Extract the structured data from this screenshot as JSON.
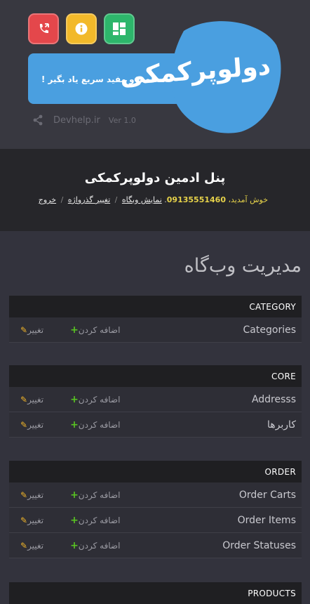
{
  "header": {
    "brand_title": "دولوپرکمکی",
    "brand_subtitle": "مختصر و مفید سریع یاد بگیر !",
    "site": "Devhelp.ir",
    "version": "Ver 1.0",
    "icons": [
      "phone-icon",
      "info-icon",
      "grid-icon"
    ],
    "colors": {
      "red": "#e4474b",
      "yellow": "#f2b92a",
      "green": "#2db66b",
      "blue": "#4a9fe0"
    }
  },
  "admin": {
    "title": "پنل ادمین دولوپرکمکی",
    "welcome": "خوش آمدید،",
    "user": "09135551460",
    "view_site": "نمایش وبگاه",
    "change_password": "تغییر گذرواژه",
    "logout": "خروج"
  },
  "main": {
    "title": "مدیریت وب‌گاه",
    "add_label": "اضافه کردن",
    "change_label": "تغییر",
    "modules": [
      {
        "name": "CATEGORY",
        "rows": [
          "Categories"
        ]
      },
      {
        "name": "CORE",
        "rows": [
          "Addresss",
          "کاربرها"
        ]
      },
      {
        "name": "ORDER",
        "rows": [
          "Order Carts",
          "Order Items",
          "Order Statuses"
        ]
      },
      {
        "name": "PRODUCTS",
        "rows": []
      }
    ]
  }
}
